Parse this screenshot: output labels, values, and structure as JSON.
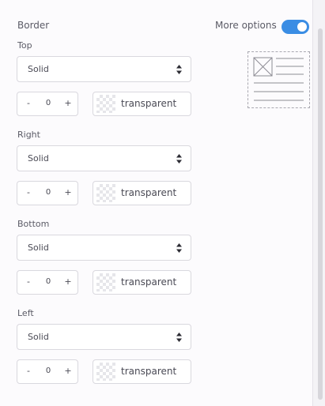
{
  "panel": {
    "title": "Border",
    "more_options_label": "More options",
    "more_options_enabled": true
  },
  "sections": [
    {
      "label": "Top",
      "style": "Solid",
      "width": "0",
      "minus": "-",
      "plus": "+",
      "color": "transparent"
    },
    {
      "label": "Right",
      "style": "Solid",
      "width": "0",
      "minus": "-",
      "plus": "+",
      "color": "transparent"
    },
    {
      "label": "Bottom",
      "style": "Solid",
      "width": "0",
      "minus": "-",
      "plus": "+",
      "color": "transparent"
    },
    {
      "label": "Left",
      "style": "Solid",
      "width": "0",
      "minus": "-",
      "plus": "+",
      "color": "transparent"
    }
  ],
  "icons": {
    "toggle": "toggle-switch-icon",
    "preview": "border-preview-icon",
    "image_placeholder": "image-placeholder-icon",
    "select_arrows": "sort-arrows-icon",
    "swatch": "transparent-swatch-icon"
  },
  "colors": {
    "accent": "#3a8de4",
    "panel_bg": "#fcfbfd",
    "border": "#d9d8de",
    "text": "#4a4a55"
  }
}
